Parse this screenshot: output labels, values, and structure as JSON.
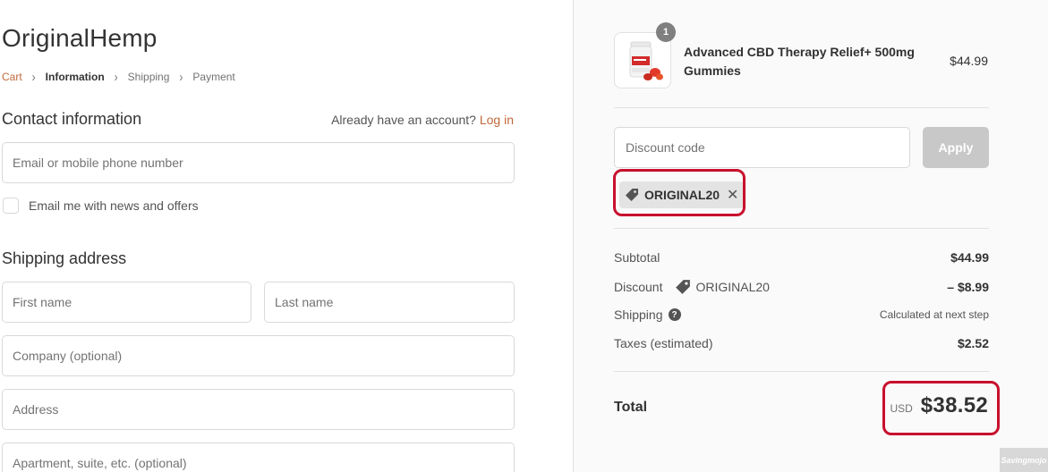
{
  "store": {
    "title": "OriginalHemp"
  },
  "breadcrumb": {
    "cart": "Cart",
    "information": "Information",
    "shipping": "Shipping",
    "payment": "Payment",
    "separator": "›"
  },
  "contact": {
    "title": "Contact information",
    "account_prompt": "Already have an account?",
    "login_label": "Log in",
    "email_placeholder": "Email or mobile phone number",
    "newsletter_label": "Email me with news and offers"
  },
  "shipping_address": {
    "title": "Shipping address",
    "first_name_placeholder": "First name",
    "last_name_placeholder": "Last name",
    "company_placeholder": "Company (optional)",
    "address_placeholder": "Address",
    "apartment_placeholder": "Apartment, suite, etc. (optional)"
  },
  "order": {
    "product": {
      "name": "Advanced CBD Therapy Relief+ 500mg Gummies",
      "price": "$44.99",
      "quantity": "1"
    },
    "discount": {
      "placeholder": "Discount code",
      "apply_label": "Apply",
      "applied_code": "ORIGINAL20",
      "remove_icon": "close-icon"
    },
    "summary": {
      "subtotal_label": "Subtotal",
      "subtotal_value": "$44.99",
      "discount_label": "Discount",
      "discount_code": "ORIGINAL20",
      "discount_value": "– $8.99",
      "shipping_label": "Shipping",
      "shipping_value": "Calculated at next step",
      "taxes_label": "Taxes (estimated)",
      "taxes_value": "$2.52"
    },
    "total": {
      "label": "Total",
      "currency": "USD",
      "amount": "$38.52"
    }
  },
  "watermark": {
    "text": "Savingmojo"
  },
  "colors": {
    "accent": "#c0693b",
    "highlight": "#c8102e",
    "sidebar_bg": "#fafafa",
    "apply_disabled": "#c8c8c8"
  }
}
